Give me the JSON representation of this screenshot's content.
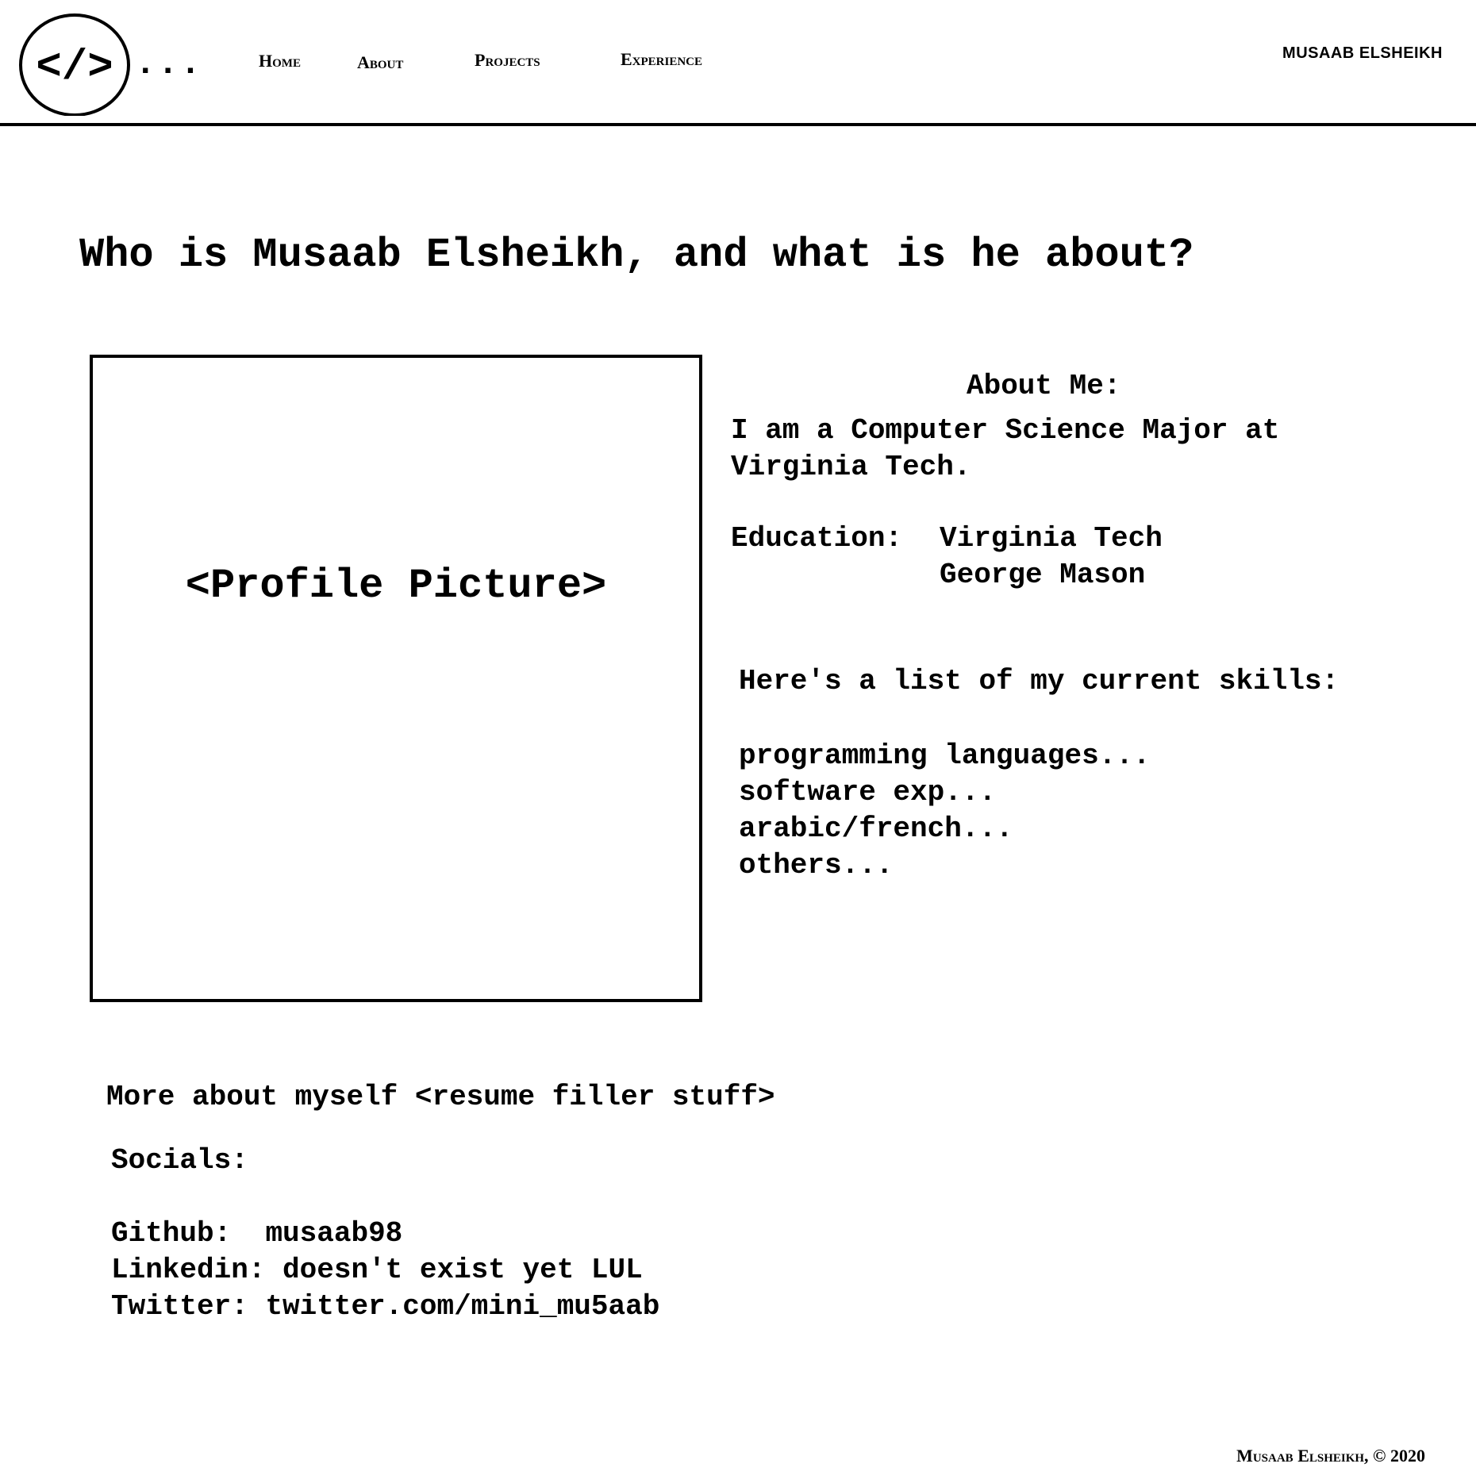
{
  "header": {
    "logo_symbol": "</>",
    "logo_dots": "...",
    "nav": {
      "home": "Home",
      "about": "About",
      "projects": "Projects",
      "experience": "Experience"
    },
    "brand_name": "MUSAAB ELSHEIKH"
  },
  "main": {
    "title": "Who is Musaab Elsheikh, and what is he about?",
    "profile_placeholder": "<Profile Picture>",
    "about": {
      "heading": "About Me:",
      "line1": "I am a Computer Science Major at",
      "line2": "Virginia Tech.",
      "education_label": "Education:",
      "education_1": "Virginia Tech",
      "education_2": "George Mason"
    },
    "skills": {
      "heading": "Here's a list of my current skills:",
      "items": [
        "programming languages...",
        "software exp...",
        "arabic/french...",
        "others..."
      ]
    },
    "more_about": "More about myself <resume filler stuff>",
    "socials": {
      "heading": "Socials:",
      "github_label": "Github:",
      "github_value": "musaab98",
      "linkedin_label": "Linkedin:",
      "linkedin_value": "doesn't exist yet LUL",
      "twitter_label": "Twitter:",
      "twitter_value": "twitter.com/mini_mu5aab"
    }
  },
  "footer": {
    "text": "Musaab Elsheikh, © 2020"
  },
  "colors": {
    "background": "#ffffff",
    "foreground": "#000000"
  },
  "icons": {
    "logo": "code-brackets-icon"
  }
}
